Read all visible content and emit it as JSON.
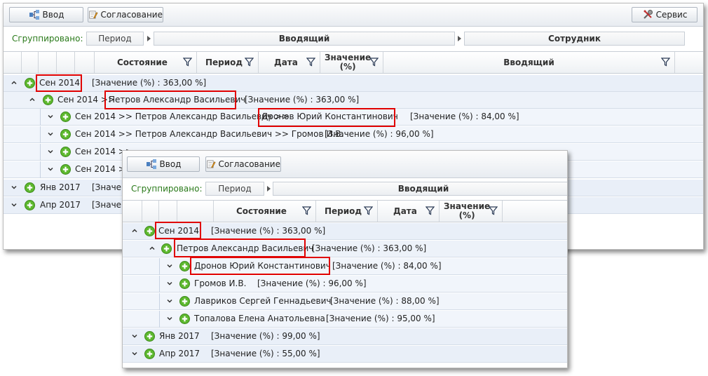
{
  "toolbar": {
    "input_label": "Ввод",
    "approval_label": "Согласование",
    "service_label": "Сервис"
  },
  "grouping": {
    "label": "Сгруппировано:",
    "chips_back": [
      "Период",
      "Вводящий",
      "Сотрудник"
    ],
    "chips_front": [
      "Период",
      "Вводящий"
    ]
  },
  "columns_back": {
    "state": "Состояние",
    "period": "Период",
    "date": "Дата",
    "value_line1": "Значение",
    "value_line2": "(%)",
    "entered_by": "Вводящий"
  },
  "columns_front": {
    "state": "Состояние",
    "period": "Период",
    "date": "Дата",
    "value_line1": "Значение",
    "value_line2": "(%)"
  },
  "rows_back": [
    {
      "label": "Сен 2014",
      "value": "[Значение (%) : 363,00 %]"
    },
    {
      "label": "Сен 2014 >>",
      "label2": "Петров Александр Васильевич",
      "value": "[Значение (%) : 363,00 %]"
    },
    {
      "label": "Сен 2014 >> Петров Александр Васильевич >>",
      "label2": "Дронов Юрий Константинович",
      "value": "[Значение (%) : 84,00 %]"
    },
    {
      "label": "Сен 2014 >> Петров Александр Васильевич >> Громов И.В.",
      "value": "[Значение (%) : 96,00 %]"
    },
    {
      "label": "Сен 2014 >>"
    },
    {
      "label": "Сен 2014 >>"
    },
    {
      "label": "Янв 2017",
      "value": "[Значен"
    },
    {
      "label": "Апр 2017",
      "value": "[Значен"
    }
  ],
  "rows_front": [
    {
      "label": "Сен 2014",
      "value": "[Значение (%) : 363,00 %]"
    },
    {
      "label": "Петров Александр Васильевич",
      "value": "[Значение (%) : 363,00 %]"
    },
    {
      "label": "Дронов Юрий Константинович",
      "value": "[Значение (%) : 84,00 %]"
    },
    {
      "label": "Громов И.В.",
      "value": "[Значение (%) : 96,00 %]"
    },
    {
      "label": "Лавриков Сергей Геннадьевич",
      "value": "[Значение (%) : 88,00 %]"
    },
    {
      "label": "Топалова Елена Анатольевна",
      "value": "[Значение (%) : 95,00 %]"
    },
    {
      "label": "Янв 2017",
      "value": "[Значение (%) : 99,00 %]"
    },
    {
      "label": "Апр 2017",
      "value": "[Значение (%) : 55,00 %]"
    }
  ],
  "icons": {
    "input": "flow-input-icon",
    "approval": "pencil-note-icon",
    "service": "tools-icon",
    "filter": "funnel-icon",
    "expand": "plus-circle-icon"
  },
  "colors": {
    "highlight": "#e00000",
    "group_label": "#2a7a1a",
    "plus_icon": "#5db82e"
  }
}
